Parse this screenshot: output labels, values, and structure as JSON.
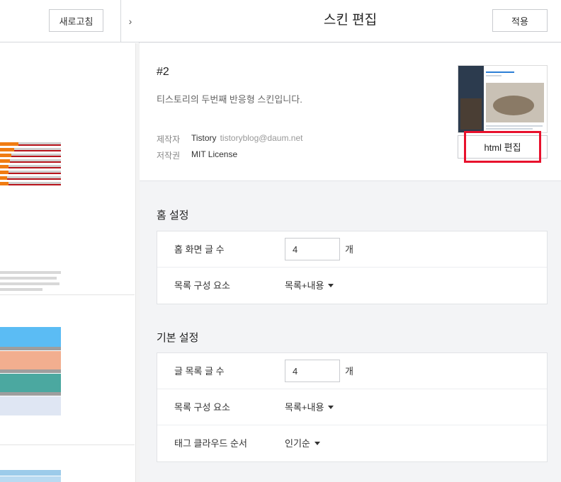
{
  "left_panel": {
    "refresh_label": "새로고침",
    "collapse_icon": "chevron-right-icon"
  },
  "header": {
    "title": "스킨 편집",
    "apply_label": "적용"
  },
  "skin": {
    "name": "#2",
    "description": "티스토리의 두번째 반응형 스킨입니다.",
    "author_label": "제작자",
    "author_name": "Tistory",
    "author_email": "tistoryblog@daum.net",
    "license_label": "저작권",
    "license_value": "MIT License",
    "html_edit_label": "html 편집"
  },
  "home_settings": {
    "title": "홈 설정",
    "rows": [
      {
        "label": "홈 화면 글 수",
        "value": "4",
        "unit": "개"
      },
      {
        "label": "목록 구성 요소",
        "selected": "목록+내용"
      }
    ]
  },
  "basic_settings": {
    "title": "기본 설정",
    "rows": [
      {
        "label": "글 목록 글 수",
        "value": "4",
        "unit": "개"
      },
      {
        "label": "목록 구성 요소",
        "selected": "목록+내용"
      },
      {
        "label": "태그 클라우드 순서",
        "selected": "인기순"
      }
    ]
  },
  "colors": {
    "highlight": "#e8112d",
    "border": "#c9cbcf",
    "panel_bg": "#f3f4f6"
  }
}
